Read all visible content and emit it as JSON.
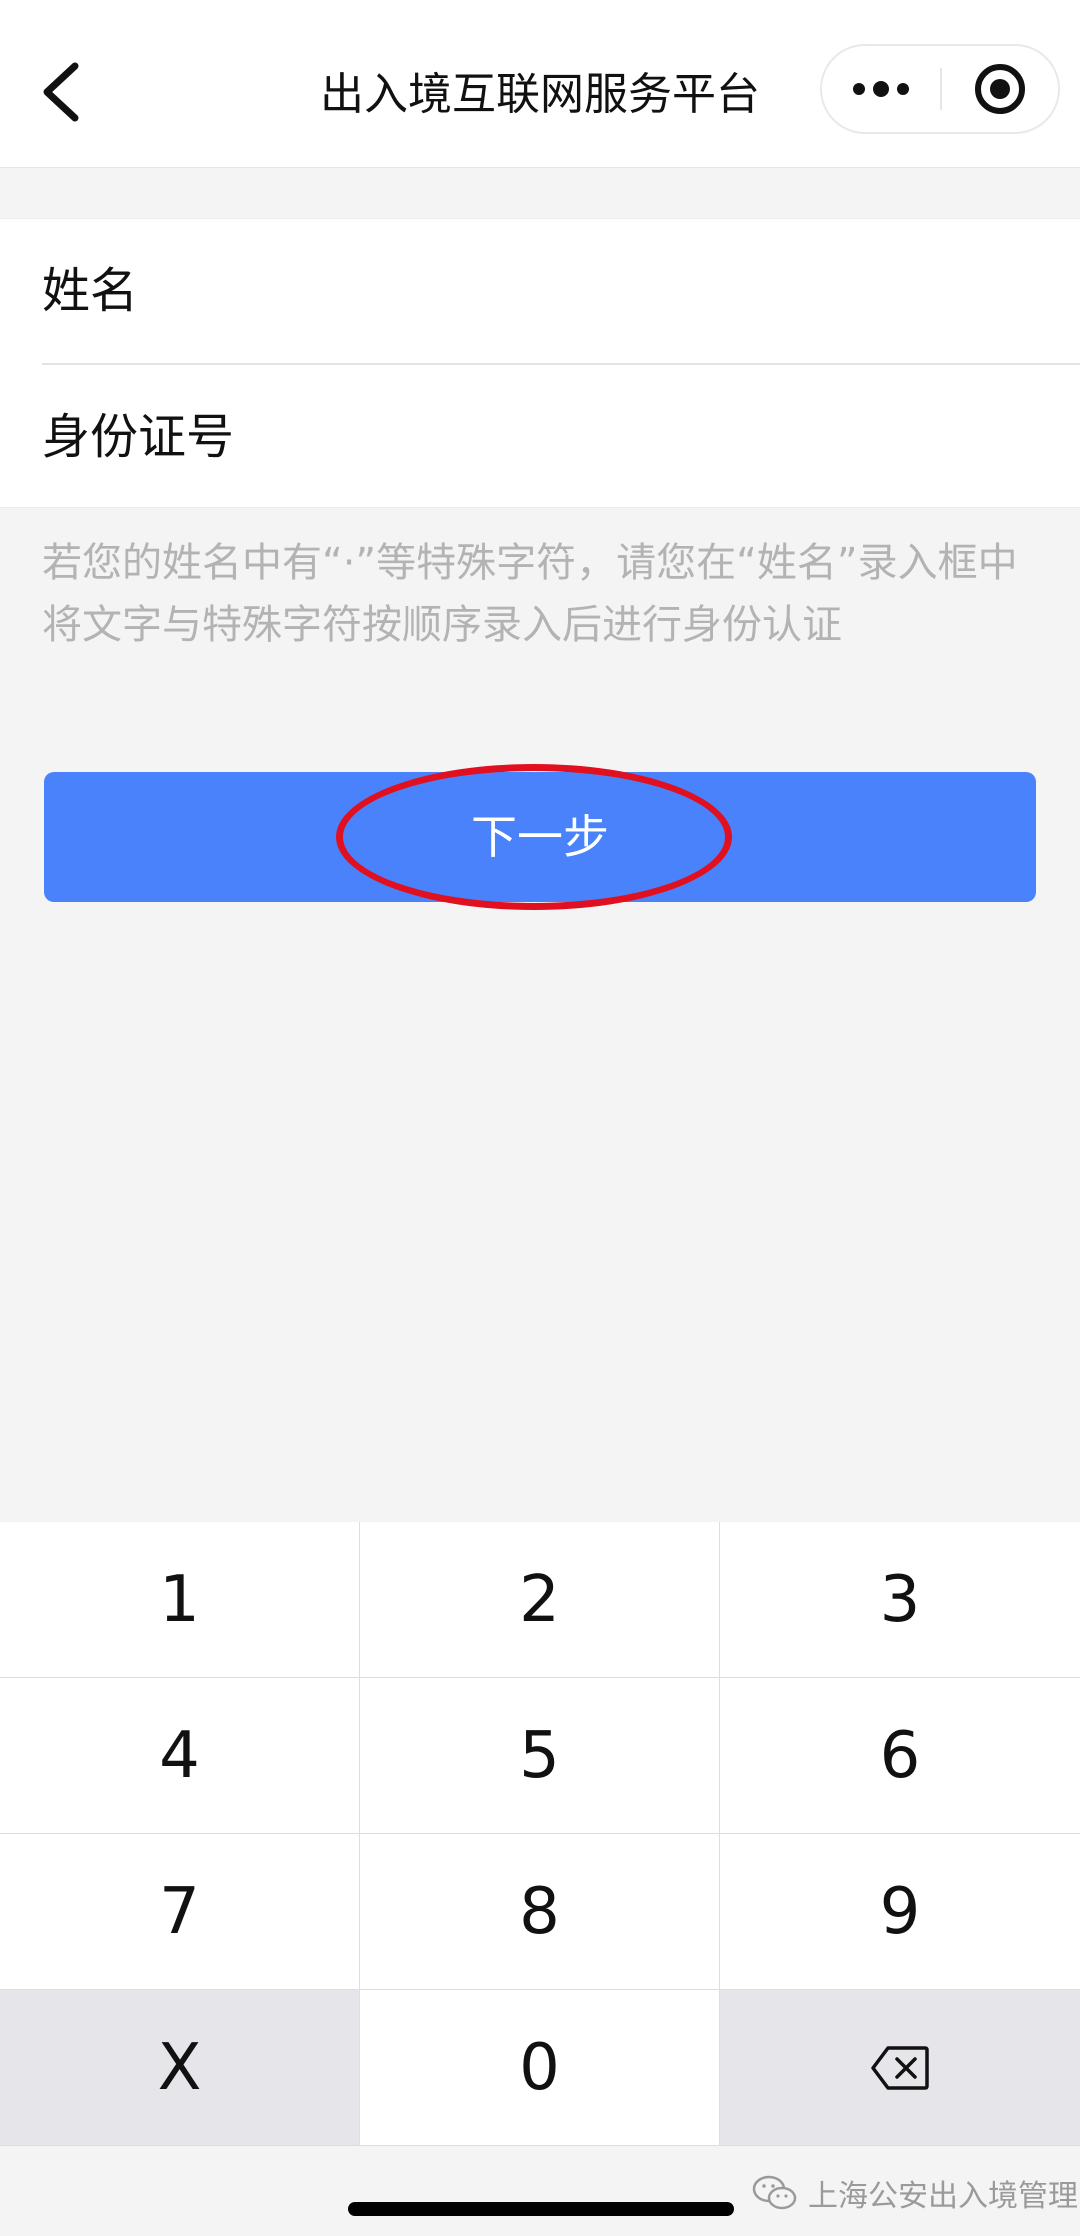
{
  "navbar": {
    "title": "出入境互联网服务平台",
    "back_icon": "chevron-left-icon",
    "more_icon": "more-dots-icon",
    "close_icon": "target-circle-icon"
  },
  "form": {
    "name_label": "姓名",
    "id_label": "身份证号"
  },
  "hint": "若您的姓名中有“·”等特殊字符，请您在“姓名”录入框中将文字与特殊字符按顺序录入后进行身份认证",
  "next_button": {
    "label": "下一步",
    "color": "#4a82fb",
    "highlight_color": "#e01020"
  },
  "keypad": {
    "keys": [
      "1",
      "2",
      "3",
      "4",
      "5",
      "6",
      "7",
      "8",
      "9",
      "X",
      "0"
    ],
    "backspace_icon": "backspace-icon"
  },
  "watermark": {
    "text": "上海公安出入境管理",
    "icon": "wechat-icon"
  }
}
